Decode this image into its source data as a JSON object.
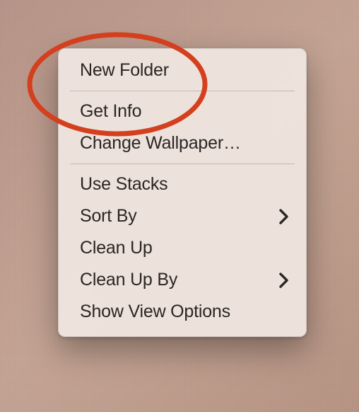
{
  "contextMenu": {
    "items": [
      {
        "label": "New Folder",
        "hasSubmenu": false
      },
      {
        "label": "Get Info",
        "hasSubmenu": false
      },
      {
        "label": "Change Wallpaper…",
        "hasSubmenu": false
      },
      {
        "label": "Use Stacks",
        "hasSubmenu": false
      },
      {
        "label": "Sort By",
        "hasSubmenu": true
      },
      {
        "label": "Clean Up",
        "hasSubmenu": false
      },
      {
        "label": "Clean Up By",
        "hasSubmenu": true
      },
      {
        "label": "Show View Options",
        "hasSubmenu": false
      }
    ]
  },
  "annotation": {
    "color": "#d43f1e"
  }
}
